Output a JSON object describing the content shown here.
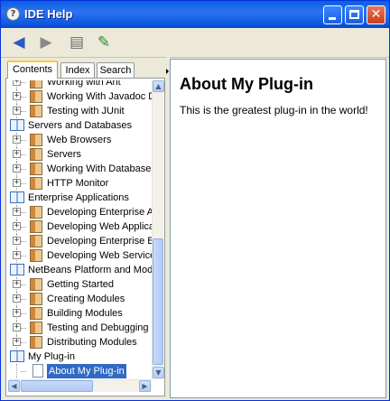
{
  "window": {
    "title": "IDE Help"
  },
  "toolbar": {
    "buttons": [
      "back",
      "forward",
      "print",
      "page-setup"
    ]
  },
  "tabs": [
    {
      "label": "Contents",
      "active": true
    },
    {
      "label": "Index",
      "active": false
    },
    {
      "label": "Search",
      "active": false
    }
  ],
  "tree": {
    "rows": [
      {
        "label": "Working with Ant",
        "type": "topic",
        "level": 1
      },
      {
        "label": "Working With Javadoc Documentation",
        "type": "topic",
        "level": 1
      },
      {
        "label": "Testing with JUnit",
        "type": "topic",
        "level": 1
      },
      {
        "label": "Servers and Databases",
        "type": "book",
        "level": 0
      },
      {
        "label": "Web Browsers",
        "type": "topic",
        "level": 1
      },
      {
        "label": "Servers",
        "type": "topic",
        "level": 1
      },
      {
        "label": "Working With Databases",
        "type": "topic",
        "level": 1
      },
      {
        "label": "HTTP Monitor",
        "type": "topic",
        "level": 1
      },
      {
        "label": "Enterprise Applications",
        "type": "book",
        "level": 0
      },
      {
        "label": "Developing Enterprise Applications",
        "type": "topic",
        "level": 1
      },
      {
        "label": "Developing Web Applications",
        "type": "topic",
        "level": 1
      },
      {
        "label": "Developing Enterprise Beans",
        "type": "topic",
        "level": 1
      },
      {
        "label": "Developing Web Services",
        "type": "topic",
        "level": 1
      },
      {
        "label": "NetBeans Platform and Modules",
        "type": "book",
        "level": 0
      },
      {
        "label": "Getting Started",
        "type": "topic",
        "level": 1
      },
      {
        "label": "Creating Modules",
        "type": "topic",
        "level": 1
      },
      {
        "label": "Building Modules",
        "type": "topic",
        "level": 1
      },
      {
        "label": "Testing and Debugging",
        "type": "topic",
        "level": 1
      },
      {
        "label": "Distributing Modules",
        "type": "topic",
        "level": 1
      },
      {
        "label": "My Plug-in",
        "type": "book",
        "level": 0
      },
      {
        "label": "About My Plug-in",
        "type": "page",
        "level": 1,
        "selected": true
      }
    ]
  },
  "content": {
    "heading": "About My Plug-in",
    "body": "This is the greatest plug-in in the world!"
  },
  "colors": {
    "title_bar": "#0a5fe3",
    "selection": "#316ac5",
    "tab_highlight": "#ffc83c"
  }
}
